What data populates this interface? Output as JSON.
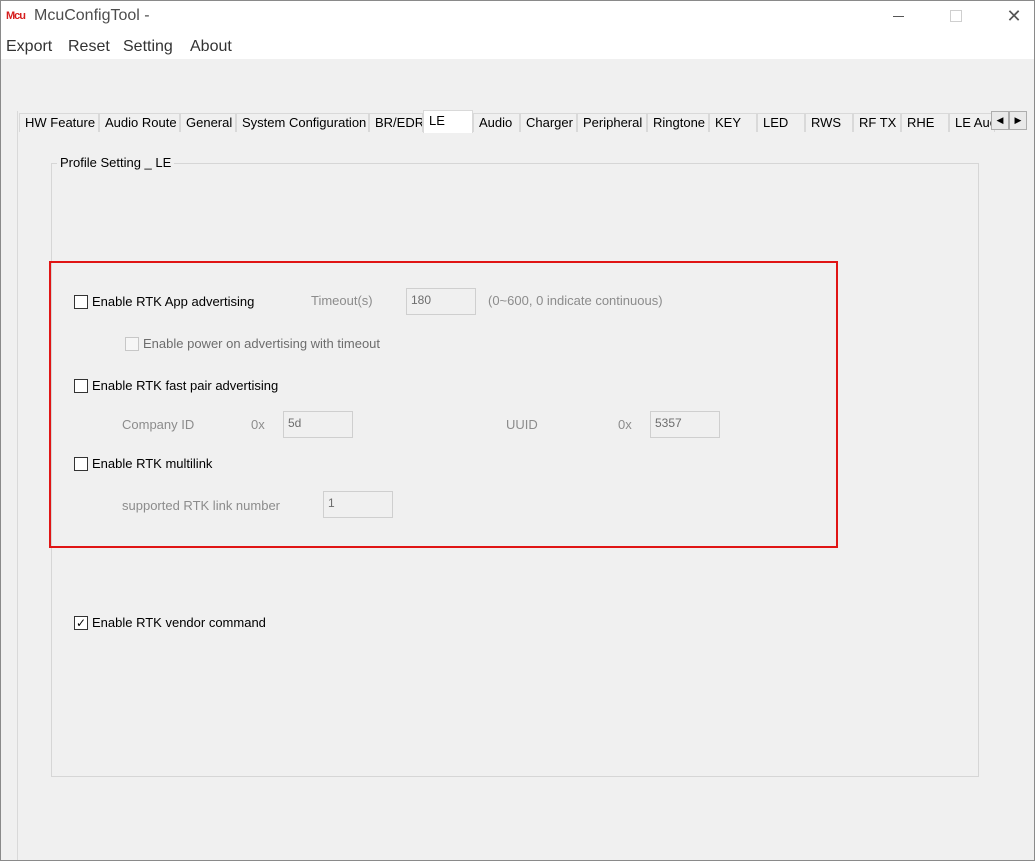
{
  "window": {
    "icon_text": "Mcu",
    "title": "McuConfigTool -",
    "minimize_glyph": "",
    "close_glyph": "✕"
  },
  "menu": [
    {
      "label": "Export"
    },
    {
      "label": "Reset"
    },
    {
      "label": "Setting"
    },
    {
      "label": "About"
    }
  ],
  "tabs": [
    {
      "label": "HW Feature"
    },
    {
      "label": "Audio Route"
    },
    {
      "label": "General"
    },
    {
      "label": "System Configuration"
    },
    {
      "label": "BR/EDR"
    },
    {
      "label": "LE",
      "active": true
    },
    {
      "label": "Audio"
    },
    {
      "label": "Charger"
    },
    {
      "label": "Peripheral"
    },
    {
      "label": "Ringtone"
    },
    {
      "label": "KEY"
    },
    {
      "label": "LED"
    },
    {
      "label": "RWS"
    },
    {
      "label": "RF TX"
    },
    {
      "label": "RHE"
    },
    {
      "label": "LE Auc"
    }
  ],
  "tab_scroll": {
    "left_glyph": "◀",
    "right_glyph": "▶"
  },
  "group": {
    "title": "Profile Setting _ LE"
  },
  "le": {
    "app_adv": {
      "label": "Enable RTK App advertising",
      "checked": false,
      "check_glyph": ""
    },
    "timeout_label": "Timeout(s)",
    "timeout_value": "180",
    "timeout_hint": "(0~600, 0 indicate continuous)",
    "power_on_adv": {
      "label": "Enable power on advertising with timeout",
      "checked": false,
      "check_glyph": ""
    },
    "fast_pair": {
      "label": "Enable RTK fast pair advertising",
      "checked": false,
      "check_glyph": ""
    },
    "company_id_label": "Company ID",
    "company_id_prefix": "0x",
    "company_id_value": "5d",
    "uuid_label": "UUID",
    "uuid_prefix": "0x",
    "uuid_value": "5357",
    "multilink": {
      "label": "Enable RTK multilink",
      "checked": false,
      "check_glyph": ""
    },
    "link_number_label": "supported RTK link number",
    "link_number_value": "1",
    "vendor_cmd": {
      "label": "Enable RTK vendor command",
      "checked": true,
      "check_glyph": "✓"
    }
  },
  "colors": {
    "highlight": "#e01515",
    "background": "#f0f0f0"
  }
}
